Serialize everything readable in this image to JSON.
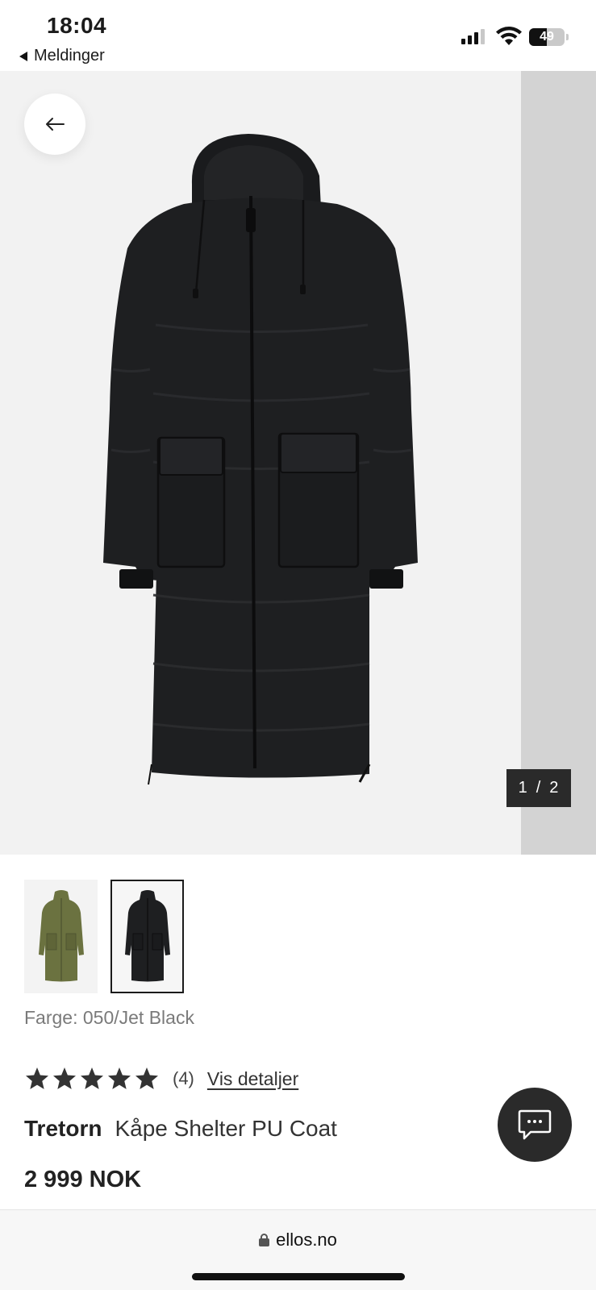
{
  "status_bar": {
    "time": "18:04",
    "back_app": "Meldinger",
    "battery_percent": "49",
    "battery_level": 0.49
  },
  "gallery": {
    "current": "1",
    "separator": "/",
    "total": "2"
  },
  "colors": {
    "options": [
      "olive",
      "black"
    ],
    "selected_index": 1,
    "label": "Farge: 050/Jet Black"
  },
  "rating": {
    "stars": 5,
    "count": "(4)",
    "details_link": "Vis detaljer"
  },
  "product": {
    "brand": "Tretorn",
    "name": "Kåpe Shelter PU Coat",
    "price": "2 999 NOK"
  },
  "browser": {
    "url": "ellos.no"
  },
  "icons": {
    "back": "arrow-left-icon",
    "chat": "chat-bubble-icon",
    "lock": "lock-icon"
  },
  "palette": {
    "coat_black": "#1e1f21",
    "coat_olive": "#6b7240",
    "dark_ui": "#2a2a2a"
  }
}
